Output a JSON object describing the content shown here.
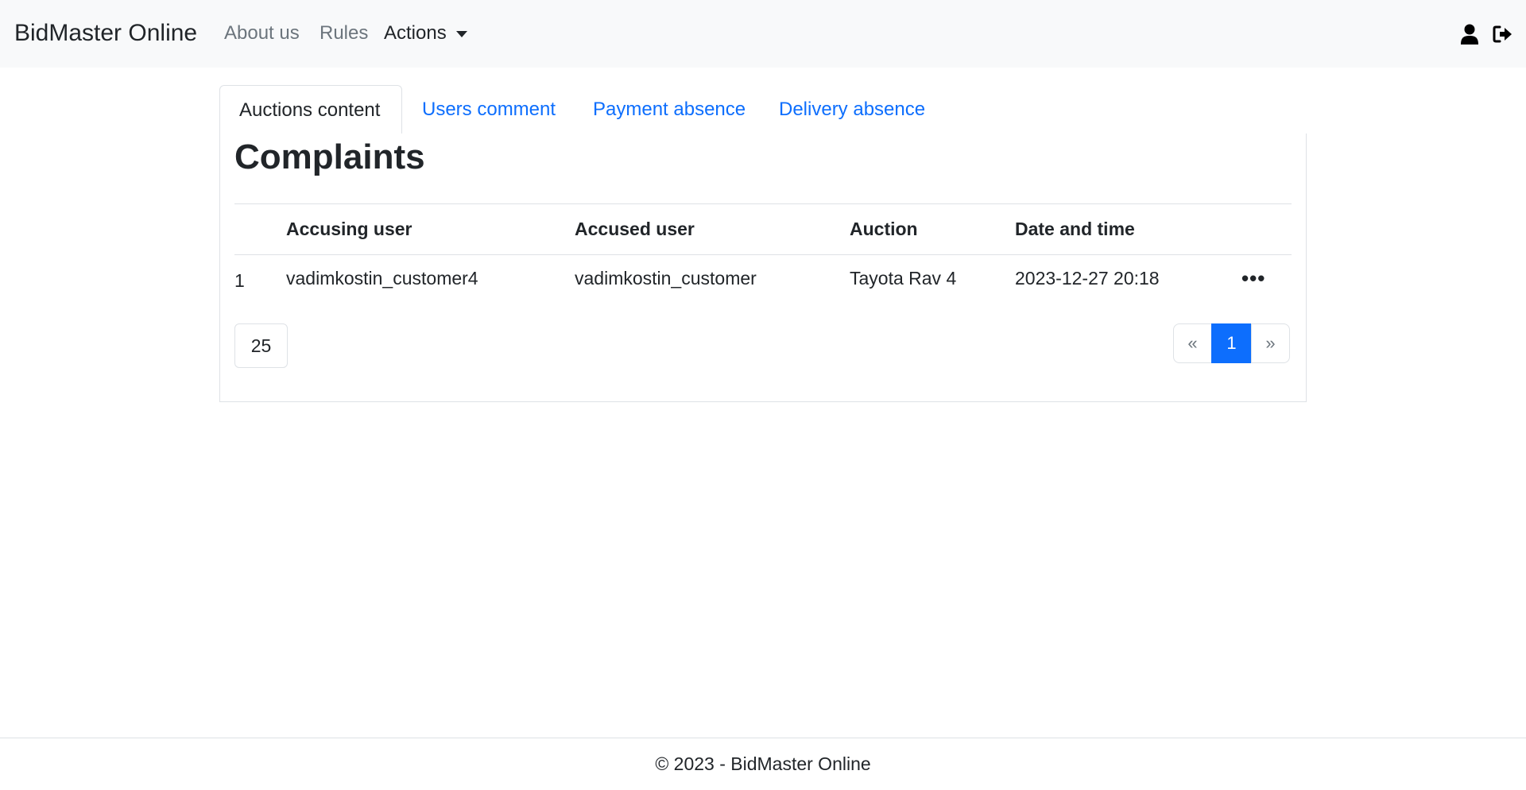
{
  "navbar": {
    "brand": "BidMaster Online",
    "links": [
      {
        "label": "About us"
      },
      {
        "label": "Rules"
      }
    ],
    "actions_label": "Actions",
    "icons": [
      "user-icon",
      "logout-icon"
    ]
  },
  "tabs": [
    {
      "label": "Auctions content",
      "active": true
    },
    {
      "label": "Users comment",
      "active": false
    },
    {
      "label": "Payment absence",
      "active": false
    },
    {
      "label": "Delivery absence",
      "active": false
    }
  ],
  "main": {
    "title": "Complaints",
    "table": {
      "headers": [
        "",
        "Accusing user",
        "Accused user",
        "Auction",
        "Date and time",
        ""
      ],
      "rows": [
        {
          "num": "1",
          "accusing_user": "vadimkostin_customer4",
          "accused_user": "vadimkostin_customer",
          "auction": "Tayota Rav 4",
          "datetime": "2023-12-27 20:18",
          "more": "•••"
        }
      ]
    },
    "page_size": "25",
    "pagination": {
      "prev": "«",
      "current": "1",
      "next": "»"
    }
  },
  "footer": {
    "text": "© 2023 - BidMaster Online"
  },
  "colors": {
    "primary": "#0d6efd",
    "navbar_bg": "#f8f9fa",
    "border": "#dee2e6",
    "muted": "#6c757d"
  }
}
